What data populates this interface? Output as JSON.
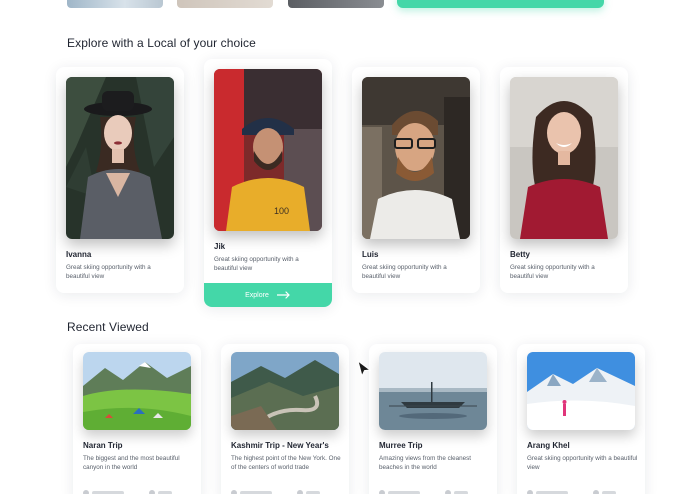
{
  "colors": {
    "accent": "#44d7a8",
    "text": "#1f2430",
    "muted": "#59606b"
  },
  "sections": {
    "locals_title": "Explore with a Local of your choice",
    "recent_title": "Recent Viewed"
  },
  "locals": [
    {
      "name": "Ivanna",
      "desc": "Great skiing opportunity with a beautiful view"
    },
    {
      "name": "Jik",
      "desc": "Great skiing opportunity with a beautiful view",
      "button": "Explore"
    },
    {
      "name": "Luis",
      "desc": "Great skiing opportunity with a beautiful view"
    },
    {
      "name": "Betty",
      "desc": "Great skiing opportunity with a beautiful view"
    }
  ],
  "trips": [
    {
      "name": "Naran Trip",
      "desc": "The biggest and the most beautiful canyon in the world"
    },
    {
      "name": "Kashmir Trip - New Year's",
      "desc": "The highest point of the New York. One of the centers of world trade"
    },
    {
      "name": "Murree Trip",
      "desc": "Amazing views from the cleanest beaches in the world"
    },
    {
      "name": "Arang Khel",
      "desc": "Great skiing opportunity with a beautiful view"
    }
  ],
  "icons": {
    "explore_arrow": "arrow-right-icon",
    "pointer": "cursor-icon"
  }
}
